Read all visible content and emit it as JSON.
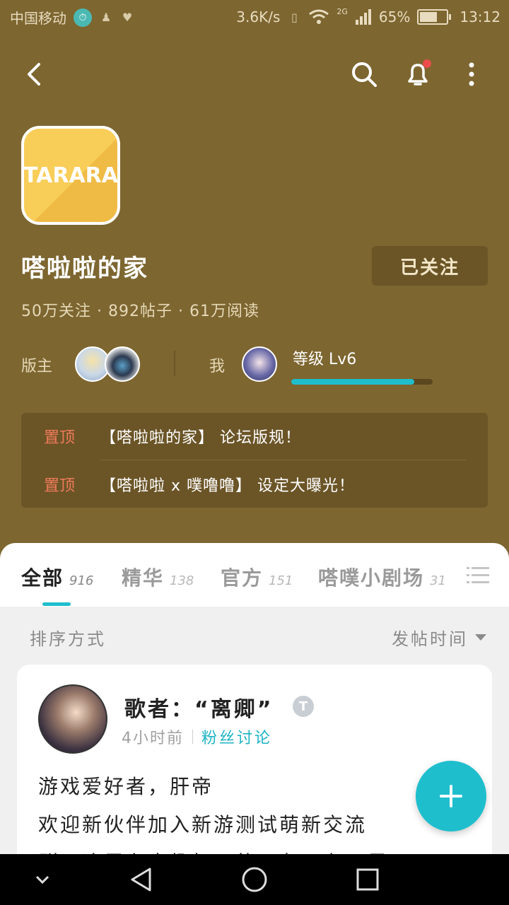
{
  "status_bar": {
    "carrier": "中国移动",
    "net_speed": "3.6K/s",
    "network_type": "2G",
    "battery_percent": "65%",
    "battery_level": 0.65,
    "time": "13:12"
  },
  "forum": {
    "logo_text": "TARARA",
    "title": "嗒啦啦的家",
    "follow_label": "已关注",
    "stats": "50万关注 · 892帖子 · 61万阅读",
    "moderator_label": "版主",
    "me_label": "我",
    "level_text": "等级 Lv6",
    "level_progress": 0.87
  },
  "pinned": [
    {
      "tag": "置顶",
      "text": "【嗒啦啦的家】 论坛版规！"
    },
    {
      "tag": "置顶",
      "text": "【嗒啦啦 x 噗噜噜】 设定大曝光！"
    }
  ],
  "tabs": [
    {
      "label": "全部",
      "count": "916"
    },
    {
      "label": "精华",
      "count": "138"
    },
    {
      "label": "官方",
      "count": "151"
    },
    {
      "label": "嗒噗小剧场",
      "count": "31"
    }
  ],
  "sort": {
    "label": "排序方式",
    "selected": "发帖时间"
  },
  "post": {
    "title": "歌者：“离卿”",
    "badge": "T",
    "time": "4小时前",
    "category": "粉丝讨论",
    "line1": "游戏爱好者，肝帝",
    "line2": "欢迎新伙伴加入新游测试萌新交流",
    "line3": "群，这里有志趣相同的朋友，有无尽"
  },
  "colors": {
    "header_bg": "#7d6630",
    "accent": "#1fbecd",
    "pin_tag": "#f07a5a"
  }
}
